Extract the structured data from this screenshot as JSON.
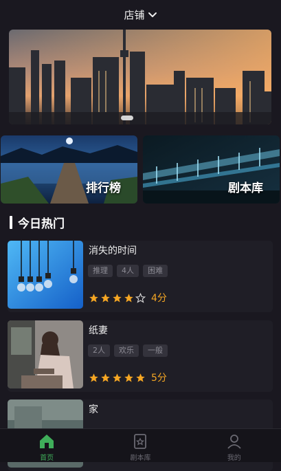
{
  "header": {
    "store_label": "店铺"
  },
  "quick_links": [
    {
      "label": "排行榜"
    },
    {
      "label": "剧本库"
    }
  ],
  "section": {
    "title": "今日热门"
  },
  "items": [
    {
      "name": "消失的时间",
      "tags": [
        "推理",
        "4人",
        "困难"
      ],
      "rating": 4,
      "score": "4分"
    },
    {
      "name": "纸妻",
      "tags": [
        "2人",
        "欢乐",
        "一般"
      ],
      "rating": 5,
      "score": "5分"
    },
    {
      "name": "家",
      "tags": [],
      "rating": 0,
      "score": ""
    }
  ],
  "tabbar": {
    "tabs": [
      {
        "label": "首页",
        "icon": "home-icon",
        "active": true
      },
      {
        "label": "剧本库",
        "icon": "script-library-icon",
        "active": false
      },
      {
        "label": "我的",
        "icon": "user-icon",
        "active": false
      }
    ]
  },
  "colors": {
    "accent": "#3fae5a",
    "star": "#f5a623",
    "background": "#1a1820"
  }
}
